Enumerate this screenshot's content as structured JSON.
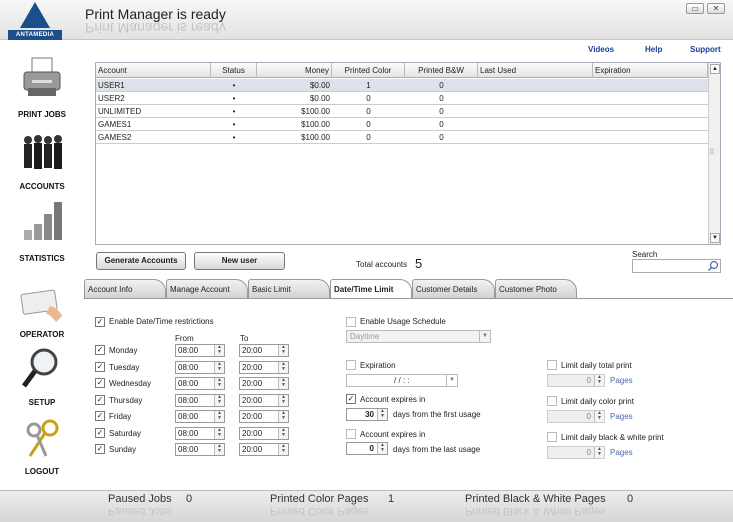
{
  "app": {
    "title": "Print Manager is ready",
    "logo_text": "ANTAMEDIA",
    "minimize": "▭",
    "close": "✕"
  },
  "links": {
    "videos": "Videos",
    "help": "Help",
    "support": "Support"
  },
  "sidebar": [
    {
      "label": "PRINT JOBS",
      "icon": "printer-icon"
    },
    {
      "label": "ACCOUNTS",
      "icon": "people-icon"
    },
    {
      "label": "STATISTICS",
      "icon": "bar-chart-icon"
    },
    {
      "label": "OPERATOR",
      "icon": "id-card-icon"
    },
    {
      "label": "SETUP",
      "icon": "magnifier-icon"
    },
    {
      "label": "LOGOUT",
      "icon": "keys-icon"
    }
  ],
  "table": {
    "columns": [
      "Account",
      "Status",
      "Money",
      "Printed Color",
      "Printed B&W",
      "Last Used",
      "Expiration"
    ],
    "rows": [
      {
        "account": "USER1",
        "status": "•",
        "money": "$0.00",
        "color": "1",
        "bw": "0",
        "last": "",
        "exp": ""
      },
      {
        "account": "USER2",
        "status": "•",
        "money": "$0.00",
        "color": "0",
        "bw": "0",
        "last": "",
        "exp": ""
      },
      {
        "account": "UNLIMITED",
        "status": "•",
        "money": "$100.00",
        "color": "0",
        "bw": "0",
        "last": "",
        "exp": ""
      },
      {
        "account": "GAMES1",
        "status": "•",
        "money": "$100.00",
        "color": "0",
        "bw": "0",
        "last": "",
        "exp": ""
      },
      {
        "account": "GAMES2",
        "status": "•",
        "money": "$100.00",
        "color": "0",
        "bw": "0",
        "last": "",
        "exp": ""
      }
    ],
    "selected_row": 0
  },
  "actions": {
    "generate": "Generate Accounts",
    "new_user": "New user"
  },
  "total": {
    "label": "Total accounts",
    "value": "5"
  },
  "search": {
    "label": "Search",
    "value": ""
  },
  "tabs": [
    "Account Info",
    "Manage Account",
    "Basic Limit",
    "Date/Time Limit",
    "Customer Details",
    "Customer Photo"
  ],
  "active_tab": "Date/Time Limit",
  "datetime": {
    "enable_label": "Enable Date/Time restrictions",
    "from_label": "From",
    "to_label": "To",
    "days": [
      {
        "day": "Monday",
        "from": "08:00",
        "to": "20:00"
      },
      {
        "day": "Tuesday",
        "from": "08:00",
        "to": "20:00"
      },
      {
        "day": "Wednesday",
        "from": "08:00",
        "to": "20:00"
      },
      {
        "day": "Thursday",
        "from": "08:00",
        "to": "20:00"
      },
      {
        "day": "Friday",
        "from": "08:00",
        "to": "20:00"
      },
      {
        "day": "Saturday",
        "from": "08:00",
        "to": "20:00"
      },
      {
        "day": "Sunday",
        "from": "08:00",
        "to": "20:00"
      }
    ]
  },
  "schedule": {
    "enable_label": "Enable Usage Schedule",
    "option": "Daytime",
    "expiration_label": "Expiration",
    "expiration_value": " / /   :  :",
    "expires_in_label": "Account expires in",
    "expires_first_value": "30",
    "expires_first_suffix": "days from the first usage",
    "expires_last_value": "0",
    "expires_last_suffix": "days from the last usage"
  },
  "limits": [
    {
      "label": "Limit daily total print",
      "value": "0",
      "unit": "Pages"
    },
    {
      "label": "Limit daily color print",
      "value": "0",
      "unit": "Pages"
    },
    {
      "label": "Limit daily black & white print",
      "value": "0",
      "unit": "Pages"
    }
  ],
  "status": {
    "paused_label": "Paused Jobs",
    "paused_value": "0",
    "color_label": "Printed Color Pages",
    "color_value": "1",
    "bw_label": "Printed Black & White Pages",
    "bw_value": "0"
  },
  "colors": {
    "accent": "#1b4f8c",
    "link": "#1a3e9a",
    "selected_row": "#dde2ea"
  }
}
